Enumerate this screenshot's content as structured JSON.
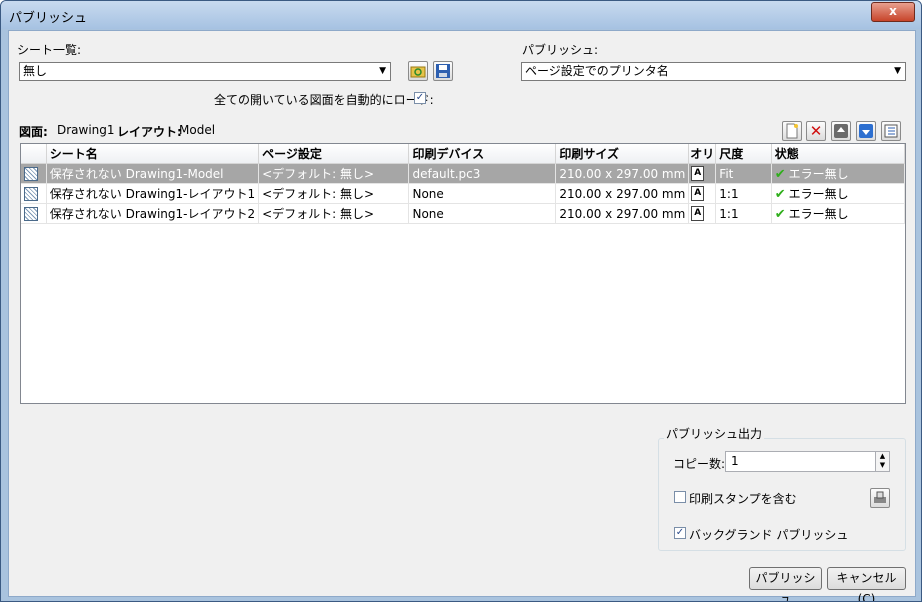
{
  "window": {
    "title": "パブリッシュ",
    "close_glyph": "x"
  },
  "sheet_list": {
    "label": "シート一覧:",
    "value": "無し"
  },
  "publish_to": {
    "label": "パブリッシュ:",
    "value": "ページ設定でのプリンタ名"
  },
  "auto_load": {
    "label": "全ての開いている図面を自動的にロード:",
    "checked": true
  },
  "drawing_info": {
    "drawing_label": "図面:",
    "drawing_value": "Drawing1",
    "layout_label": "レイアウト:",
    "layout_value": "Model"
  },
  "table": {
    "headers": [
      "シート名",
      "ページ設定",
      "印刷デバイス",
      "印刷サイズ",
      "オリ",
      "尺度",
      "状態"
    ],
    "rows": [
      {
        "sheet": "保存されない Drawing1-Model",
        "page_setup": "<デフォルト: 無し>",
        "device": "default.pc3",
        "size": "210.00 x 297.00 mm",
        "orient": "A",
        "scale": "Fit",
        "status": "エラー無し",
        "selected": true
      },
      {
        "sheet": "保存されない Drawing1-レイアウト1",
        "page_setup": "<デフォルト: 無し>",
        "device": "None",
        "size": "210.00 x 297.00 mm",
        "orient": "A",
        "scale": "1:1",
        "status": "エラー無し",
        "selected": false
      },
      {
        "sheet": "保存されない Drawing1-レイアウト2",
        "page_setup": "<デフォルト: 無し>",
        "device": "None",
        "size": "210.00 x 297.00 mm",
        "orient": "A",
        "scale": "1:1",
        "status": "エラー無し",
        "selected": false
      }
    ]
  },
  "publish_output": {
    "title": "パブリッシュ出力",
    "copies_label": "コピー数:",
    "copies_value": "1",
    "stamp_label": "印刷スタンプを含む",
    "stamp_checked": false,
    "background_label": "バックグランド パブリッシュ",
    "background_checked": true
  },
  "buttons": {
    "publish": "パブリッシュ",
    "cancel": "キャンセル(C)"
  },
  "colors": {
    "accent": "#3b5a82",
    "selection": "#a6a6a6",
    "ok": "#2fae1b",
    "delete": "#d01010"
  },
  "icons": [
    "load-sheet-list-icon",
    "save-sheet-list-icon",
    "add-sheet-icon",
    "remove-sheet-icon",
    "move-up-icon",
    "move-down-icon",
    "sheet-details-icon",
    "stamp-settings-icon"
  ]
}
